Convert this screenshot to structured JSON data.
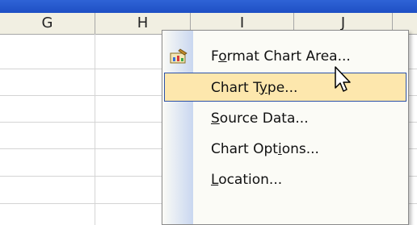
{
  "column_headers": [
    "G",
    "H",
    "I",
    "J"
  ],
  "context_menu": {
    "items": [
      {
        "pre": "F",
        "ul": "o",
        "post": "rmat Chart Area...",
        "icon": "format-chart-area-icon"
      },
      {
        "pre": "Chart T",
        "ul": "y",
        "post": "pe...",
        "highlighted": true
      },
      {
        "pre": "",
        "ul": "S",
        "post": "ource Data..."
      },
      {
        "pre": "Chart Opt",
        "ul": "i",
        "post": "ons..."
      },
      {
        "pre": "",
        "ul": "L",
        "post": "ocation..."
      }
    ]
  },
  "cursor": "arrow-pointer-icon",
  "colors": {
    "title_bar": "#1e4fc4",
    "menu_highlight": "#fde7ad",
    "menu_highlight_border": "#2b51a8"
  }
}
